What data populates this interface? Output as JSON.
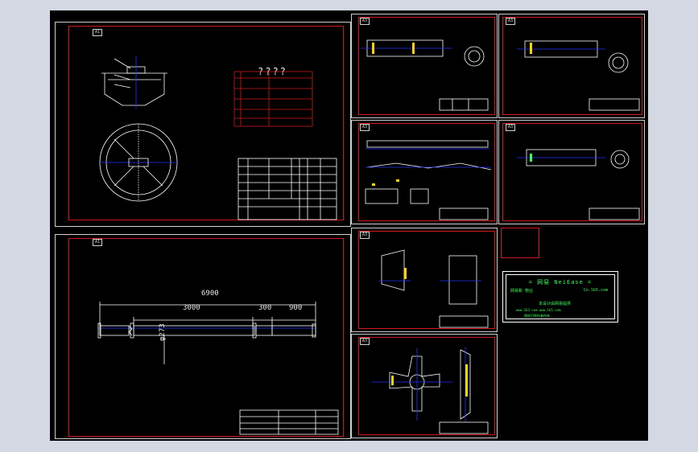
{
  "colors": {
    "background": "#d3d8e3",
    "canvas": "#000000",
    "frame": "#d01818",
    "line": "#ffffff",
    "center_line": "#2433ff",
    "dimension": "#e8e8e8",
    "hatch": "#ffd400",
    "watermark": "#39ff5a"
  },
  "sheet_tags": {
    "main_top": "A1",
    "main_bottom": "A1",
    "small": "A3"
  },
  "main_top": {
    "title": "????"
  },
  "pipe_drawing": {
    "dims": {
      "total": "6900",
      "seg_a": "3000",
      "seg_b": "300",
      "seg_c": "900",
      "diameter": "φ273"
    }
  },
  "watermark": {
    "line1": "= 网易 NeiEase =",
    "line2_left": "网易新 物业",
    "line2_right": "Co.lb5.com",
    "line3": "本设计由网易提供",
    "line4": "www.163.com  www.lb5.com",
    "line5": "版权归原作者所有"
  }
}
